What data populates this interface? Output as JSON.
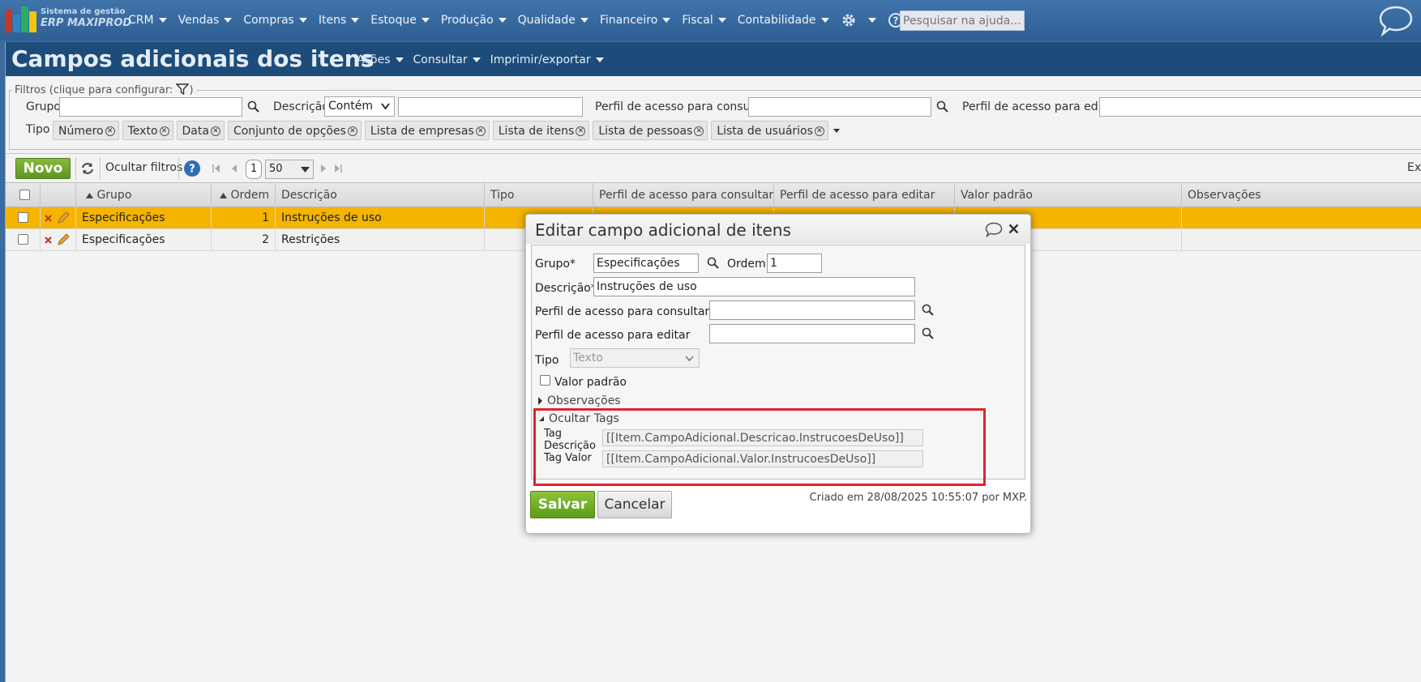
{
  "app": {
    "logo_line1": "Sistema de gestão",
    "logo_line2": "ERP MAXIPROD",
    "brand_colors": [
      "#c0392b",
      "#2e86c1",
      "#27ae60",
      "#f1c40f"
    ]
  },
  "nav": {
    "items": [
      {
        "label": "CRM"
      },
      {
        "label": "Vendas"
      },
      {
        "label": "Compras"
      },
      {
        "label": "Itens"
      },
      {
        "label": "Estoque"
      },
      {
        "label": "Produção"
      },
      {
        "label": "Qualidade"
      },
      {
        "label": "Financeiro"
      },
      {
        "label": "Fiscal"
      },
      {
        "label": "Contabilidade"
      }
    ],
    "settings_icon": "gear-icon",
    "help_icon": "help-icon",
    "help_search_placeholder": "Pesquisar na ajuda...",
    "chat_icon": "chat-bubble-icon"
  },
  "page": {
    "title": "Campos adicionais dos itens",
    "menu": [
      {
        "label": "Ações"
      },
      {
        "label": "Consultar"
      },
      {
        "label": "Imprimir/exportar"
      }
    ]
  },
  "filters": {
    "legend": "Filtros (clique para configurar:",
    "legend_close": ")",
    "grupo_label": "Grupo",
    "descricao_label": "Descrição",
    "descricao_mode": "Contém",
    "perfil_consultar_label": "Perfil de acesso para consultar",
    "perfil_editar_label": "Perfil de acesso para editar",
    "tipo_label": "Tipo",
    "tipo_chips": [
      "Número",
      "Texto",
      "Data",
      "Conjunto de opções",
      "Lista de empresas",
      "Lista de itens",
      "Lista de pessoas",
      "Lista de usuários"
    ]
  },
  "toolbar": {
    "novo_label": "Novo",
    "hide_filters_label": "Ocultar filtros",
    "current_page": "1",
    "page_size": "50",
    "export_label": "Ex"
  },
  "grid": {
    "headers": {
      "grupo": "Grupo",
      "ordem": "Ordem",
      "descricao": "Descrição",
      "tipo": "Tipo",
      "perfil_consultar": "Perfil de acesso para consultar",
      "perfil_editar": "Perfil de acesso para editar",
      "valor_padrao": "Valor padrão",
      "observacoes": "Observações"
    },
    "rows": [
      {
        "grupo": "Especificações",
        "ordem": "1",
        "descricao": "Instruções de uso"
      },
      {
        "grupo": "Especificações",
        "ordem": "2",
        "descricao": "Restrições"
      }
    ],
    "selected_row_color": "#f4b400"
  },
  "dialog": {
    "title": "Editar campo adicional de itens",
    "grupo_label": "Grupo*",
    "grupo_value": "Especificações",
    "ordem_label": "Ordem",
    "ordem_value": "1",
    "descricao_label": "Descrição*",
    "descricao_value": "Instruções de uso",
    "perfil_consultar_label": "Perfil de acesso para consultar",
    "perfil_editar_label": "Perfil de acesso para editar",
    "tipo_label": "Tipo",
    "tipo_value": "Texto",
    "valor_padrao_label": "Valor padrão",
    "observacoes_label": "Observações",
    "ocultar_tags_label": "Ocultar Tags",
    "tag_descricao_label_1": "Tag",
    "tag_descricao_label_2": "Descrição",
    "tag_descricao_value": "[[Item.CampoAdicional.Descricao.InstrucoesDeUso]]",
    "tag_valor_label": "Tag Valor",
    "tag_valor_value": "[[Item.CampoAdicional.Valor.InstrucoesDeUso]]",
    "salvar_label": "Salvar",
    "cancelar_label": "Cancelar",
    "created_text": "Criado em 28/08/2025 10:55:07 por MXP.",
    "highlight_color": "#e0232d"
  }
}
